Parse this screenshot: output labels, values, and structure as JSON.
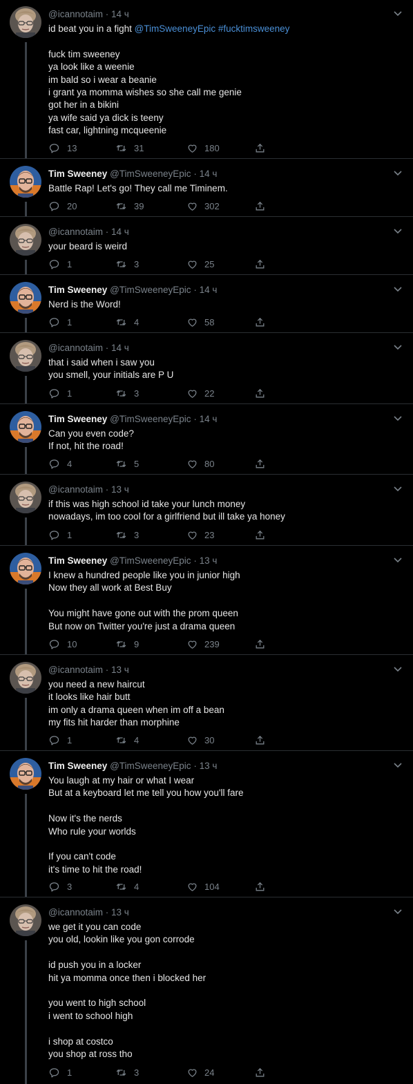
{
  "tweets": [
    {
      "author_name": "",
      "handle": "@icannotaim",
      "time": "14 ч",
      "avatar": "icannotaim",
      "lines": [
        "id beat you in a fight @TimSweeneyEpic #fucktimsweeney",
        "",
        "fuck tim sweeney",
        "ya look like a weenie",
        "im bald so i wear a beanie",
        "i grant ya momma wishes so she call me genie",
        "got her in a bikini",
        "ya wife said ya dick is teeny",
        "fast car, lightning mcqueenie"
      ],
      "replies": "13",
      "retweets": "31",
      "likes": "180"
    },
    {
      "author_name": "Tim Sweeney",
      "handle": "@TimSweeneyEpic",
      "time": "14 ч",
      "avatar": "tim",
      "lines": [
        "Battle Rap! Let's go! They call me Timinem."
      ],
      "replies": "20",
      "retweets": "39",
      "likes": "302"
    },
    {
      "author_name": "",
      "handle": "@icannotaim",
      "time": "14 ч",
      "avatar": "icannotaim",
      "lines": [
        "your beard is weird"
      ],
      "replies": "1",
      "retweets": "3",
      "likes": "25"
    },
    {
      "author_name": "Tim Sweeney",
      "handle": "@TimSweeneyEpic",
      "time": "14 ч",
      "avatar": "tim",
      "lines": [
        "Nerd is the Word!"
      ],
      "replies": "1",
      "retweets": "4",
      "likes": "58"
    },
    {
      "author_name": "",
      "handle": "@icannotaim",
      "time": "14 ч",
      "avatar": "icannotaim",
      "lines": [
        "that i said when i saw you",
        "you smell, your initials are P U"
      ],
      "replies": "1",
      "retweets": "3",
      "likes": "22"
    },
    {
      "author_name": "Tim Sweeney",
      "handle": "@TimSweeneyEpic",
      "time": "14 ч",
      "avatar": "tim",
      "lines": [
        "Can you even code?",
        "If not, hit the road!"
      ],
      "replies": "4",
      "retweets": "5",
      "likes": "80"
    },
    {
      "author_name": "",
      "handle": "@icannotaim",
      "time": "13 ч",
      "avatar": "icannotaim",
      "lines": [
        "if this was high school id take your lunch money",
        "nowadays, im too cool for a girlfriend but ill take ya honey"
      ],
      "replies": "1",
      "retweets": "3",
      "likes": "23"
    },
    {
      "author_name": "Tim Sweeney",
      "handle": "@TimSweeneyEpic",
      "time": "13 ч",
      "avatar": "tim",
      "lines": [
        "I knew a hundred people like you in junior high",
        "Now they all work at Best Buy",
        "",
        "You might have gone out with the prom queen",
        "But now on Twitter you're just a drama queen"
      ],
      "replies": "10",
      "retweets": "9",
      "likes": "239"
    },
    {
      "author_name": "",
      "handle": "@icannotaim",
      "time": "13 ч",
      "avatar": "icannotaim",
      "lines": [
        "you need a new haircut",
        "it looks like hair butt",
        "im only a drama queen when im off a bean",
        "my fits hit harder than morphine"
      ],
      "replies": "1",
      "retweets": "4",
      "likes": "30"
    },
    {
      "author_name": "Tim Sweeney",
      "handle": "@TimSweeneyEpic",
      "time": "13 ч",
      "avatar": "tim",
      "lines": [
        "You laugh at my hair or what I wear",
        "But at a keyboard let me tell you how you'll fare",
        "",
        "Now it's the nerds",
        "Who rule your worlds",
        "",
        "If you can't code",
        "it's time to hit the road!"
      ],
      "replies": "3",
      "retweets": "4",
      "likes": "104"
    },
    {
      "author_name": "",
      "handle": "@icannotaim",
      "time": "13 ч",
      "avatar": "icannotaim",
      "lines": [
        "we get it you can code",
        "you old, lookin like you gon corrode",
        "",
        "id push you in a locker",
        "hit ya momma once then i blocked her",
        "",
        "you went to high school",
        "i went to school high",
        "",
        "i shop at costco",
        "you shop at ross tho"
      ],
      "replies": "1",
      "retweets": "3",
      "likes": "24"
    }
  ],
  "colors": {
    "background": "#000000",
    "link": "#4a8fd6",
    "muted": "#7a828a",
    "thread_line": "#3b4148"
  }
}
